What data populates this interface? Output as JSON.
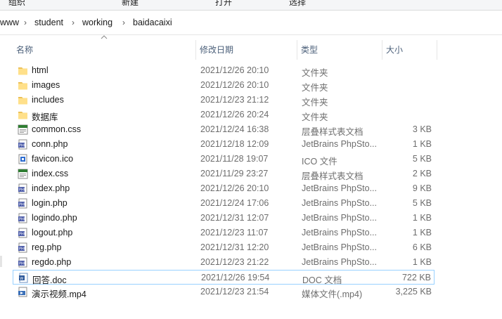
{
  "ribbon": {
    "items": [
      "组织",
      "新建",
      "打开",
      "选择"
    ]
  },
  "breadcrumb": [
    "www",
    "student",
    "working",
    "baidacaixi"
  ],
  "columns": {
    "name": "名称",
    "date": "修改日期",
    "type": "类型",
    "size": "大小"
  },
  "files": [
    {
      "name": "html",
      "date": "2021/12/26 20:10",
      "type": "文件夹",
      "size": "",
      "icon": "folder"
    },
    {
      "name": "images",
      "date": "2021/12/26 20:10",
      "type": "文件夹",
      "size": "",
      "icon": "folder"
    },
    {
      "name": "includes",
      "date": "2021/12/23 21:12",
      "type": "文件夹",
      "size": "",
      "icon": "folder"
    },
    {
      "name": "数据库",
      "date": "2021/12/26 20:24",
      "type": "文件夹",
      "size": "",
      "icon": "folder"
    },
    {
      "name": "common.css",
      "date": "2021/12/24 16:38",
      "type": "层叠样式表文档",
      "size": "3 KB",
      "icon": "css"
    },
    {
      "name": "conn.php",
      "date": "2021/12/18 12:09",
      "type": "JetBrains PhpSto...",
      "size": "1 KB",
      "icon": "php"
    },
    {
      "name": "favicon.ico",
      "date": "2021/11/28 19:07",
      "type": "ICO 文件",
      "size": "5 KB",
      "icon": "ico"
    },
    {
      "name": "index.css",
      "date": "2021/11/29 23:27",
      "type": "层叠样式表文档",
      "size": "2 KB",
      "icon": "css"
    },
    {
      "name": "index.php",
      "date": "2021/12/26 20:10",
      "type": "JetBrains PhpSto...",
      "size": "9 KB",
      "icon": "php"
    },
    {
      "name": "login.php",
      "date": "2021/12/24 17:06",
      "type": "JetBrains PhpSto...",
      "size": "5 KB",
      "icon": "php"
    },
    {
      "name": "logindo.php",
      "date": "2021/12/31 12:07",
      "type": "JetBrains PhpSto...",
      "size": "1 KB",
      "icon": "php"
    },
    {
      "name": "logout.php",
      "date": "2021/12/23 11:07",
      "type": "JetBrains PhpSto...",
      "size": "1 KB",
      "icon": "php"
    },
    {
      "name": "reg.php",
      "date": "2021/12/31 12:20",
      "type": "JetBrains PhpSto...",
      "size": "6 KB",
      "icon": "php"
    },
    {
      "name": "regdo.php",
      "date": "2021/12/23 21:22",
      "type": "JetBrains PhpSto...",
      "size": "1 KB",
      "icon": "php"
    },
    {
      "name": "回答.doc",
      "date": "2021/12/26 19:54",
      "type": "DOC 文档",
      "size": "722 KB",
      "icon": "doc",
      "selected": true
    },
    {
      "name": "演示视频.mp4",
      "date": "2021/12/23 21:54",
      "type": "媒体文件(.mp4)",
      "size": "3,225 KB",
      "icon": "mp4"
    }
  ]
}
